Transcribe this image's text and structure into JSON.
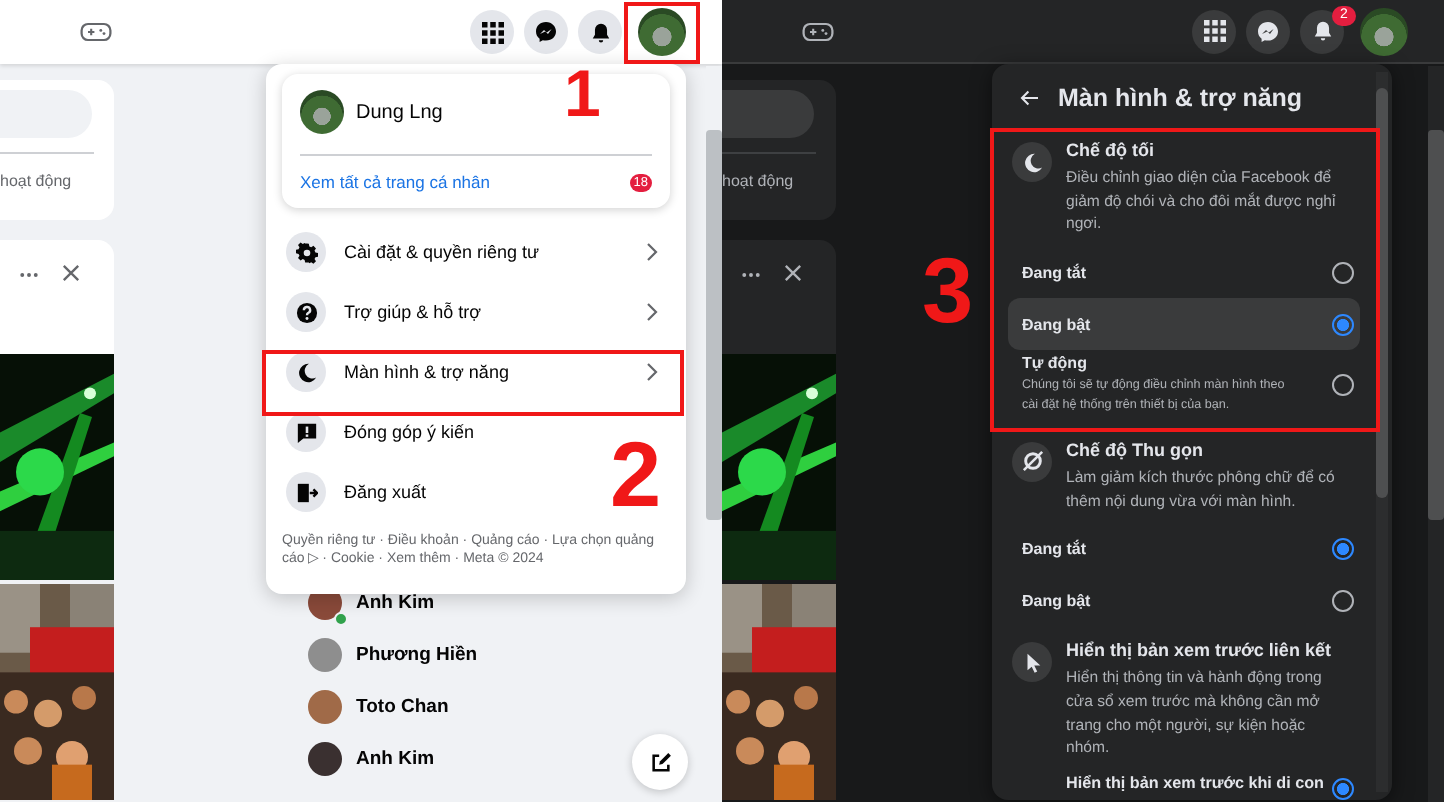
{
  "screens": [
    {
      "kind": "light",
      "feed_caption": "hoạt động",
      "contacts": [
        {
          "name": "Anh Kim",
          "online": true
        },
        {
          "name": "Phương Hiền",
          "online": false
        },
        {
          "name": "Toto Chan",
          "online": false
        },
        {
          "name": "Anh Kim",
          "online": false
        }
      ],
      "menu": {
        "kind": "account",
        "profile_name": "Dung Lng",
        "profile_link": "Xem tất cả trang cá nhân",
        "profile_badge": "18",
        "items": [
          {
            "label": "Cài đặt & quyền riêng tư",
            "chevron": true
          },
          {
            "label": "Trợ giúp & hỗ trợ",
            "chevron": true
          },
          {
            "label": "Màn hình & trợ năng",
            "chevron": true
          },
          {
            "label": "Đóng góp ý kiến",
            "chevron": false
          },
          {
            "label": "Đăng xuất",
            "chevron": false
          }
        ],
        "footer": "Quyền riêng tư · Điều khoản · Quảng cáo · Lựa chọn quảng cáo ▷ · Cookie · Xem thêm · Meta © 2024"
      },
      "annotations": [
        {
          "number": "1",
          "kind": "avatar"
        },
        {
          "number": "2",
          "kind": "menu-item"
        }
      ]
    },
    {
      "kind": "dark",
      "notification_count": "2",
      "feed_caption": "hoạt động",
      "menu": {
        "kind": "display",
        "title": "Màn hình & trợ năng",
        "sections": [
          {
            "title": "Chế độ tối",
            "description": "Điều chỉnh giao diện của Facebook để giảm độ chói và cho đôi mắt được nghỉ ngơi.",
            "options": [
              {
                "label": "Đang tắt",
                "selected": false,
                "hovered": false
              },
              {
                "label": "Đang bật",
                "selected": true,
                "hovered": true
              },
              {
                "label": "Tự động",
                "description": "Chúng tôi sẽ tự động điều chỉnh màn hình theo cài đặt hệ thống trên thiết bị của bạn.",
                "selected": false,
                "hovered": false
              }
            ]
          },
          {
            "title": "Chế độ Thu gọn",
            "description": "Làm giảm kích thước phông chữ để có thêm nội dung vừa với màn hình.",
            "options": [
              {
                "label": "Đang tắt",
                "selected": true,
                "hovered": false
              },
              {
                "label": "Đang bật",
                "selected": false,
                "hovered": false
              }
            ]
          },
          {
            "title": "Hiển thị bản xem trước liên kết",
            "description": "Hiển thị thông tin và hành động trong cửa sổ xem trước mà không cần mở trang cho một người, sự kiện hoặc nhóm."
          },
          {
            "title": "Hiển thị bản xem trước khi di con",
            "selected": true
          }
        ]
      },
      "annotations": [
        {
          "number": "3",
          "kind": "panel"
        }
      ]
    }
  ]
}
